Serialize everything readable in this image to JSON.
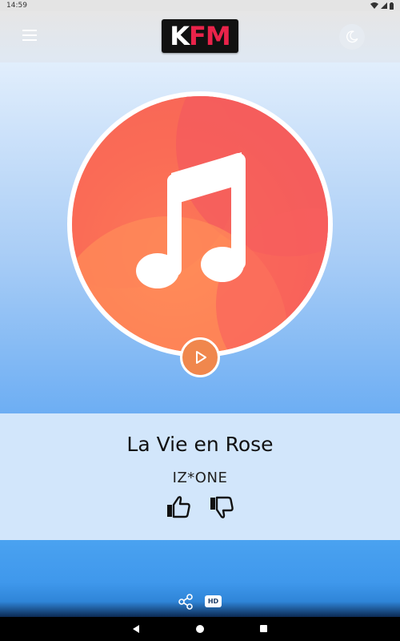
{
  "status_bar": {
    "time": "14:59",
    "icons": [
      "wifi-icon",
      "cellular-icon",
      "battery-icon"
    ]
  },
  "header": {
    "logo_primary": "K",
    "logo_accent": "FM",
    "menu_icon": "hamburger-icon",
    "theme_icon": "moon-icon"
  },
  "now_playing": {
    "title": "La Vie en Rose",
    "artist": "IZ*ONE",
    "artwork_icon": "music-note-icon",
    "play_icon": "play-icon",
    "like_icon": "thumbs-up-icon",
    "dislike_icon": "thumbs-down-icon"
  },
  "footer": {
    "share_icon": "share-icon",
    "hd_label": "HD"
  },
  "navigation": {
    "back_icon": "nav-back-icon",
    "home_icon": "nav-home-icon",
    "recents_icon": "nav-recents-icon"
  },
  "colors": {
    "brand_accent": "#e9234a",
    "art_orange": "#f35a5a",
    "play_button": "#f0874d",
    "hero_bottom": "#6daef3",
    "footer_blue": "#3f98ec"
  }
}
